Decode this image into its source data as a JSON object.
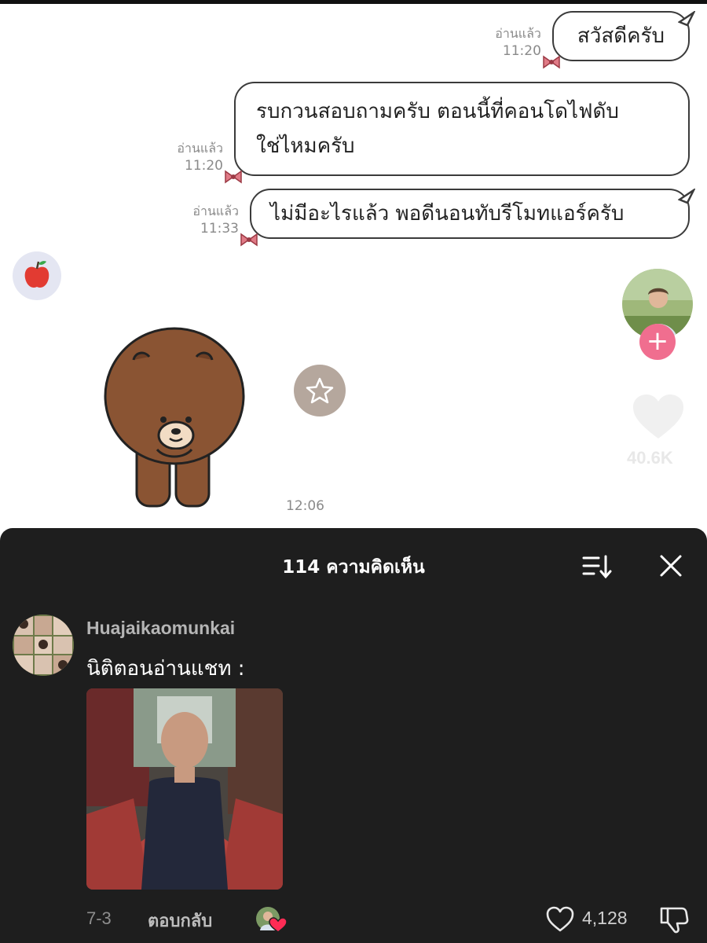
{
  "chat": {
    "messages": [
      {
        "text": "สวัสดีครับ",
        "read_label": "อ่านแล้ว",
        "time": "11:20"
      },
      {
        "line1": "รบกวนสอบถามครับ ตอนนี้ที่คอนโดไฟดับ",
        "line2": "ใช่ไหมครับ",
        "read_label": "อ่านแล้ว",
        "time": "11:20"
      },
      {
        "text": "ไม่มีอะไรแล้ว พอดีนอนทับรีโมทแอร์ครับ",
        "read_label": "อ่านแล้ว",
        "time": "11:33"
      }
    ],
    "sticker_time": "12:06",
    "colors": {
      "bear": "#8a5433",
      "bubble_border": "#3b3b3b",
      "bow": "#e07a86"
    }
  },
  "video_overlay": {
    "follow_symbol": "+",
    "like_count": "40.6K",
    "icons": [
      "star-icon",
      "plus-icon",
      "heart-icon"
    ],
    "colors": {
      "follow": "#f06e8f"
    }
  },
  "comments_panel": {
    "title": "114 ความคิดเห็น",
    "icons": [
      "sort-icon",
      "close-icon"
    ],
    "comment": {
      "username": "Huajaikaomunkai",
      "text": "นิติตอนอ่านแชท :",
      "date": "7-3",
      "reply_label": "ตอบกลับ",
      "like_count": "4,128",
      "icons": [
        "heart-icon",
        "dislike-icon"
      ]
    },
    "colors": {
      "background": "#1e1e1e",
      "creator_heart": "#fe2c55"
    }
  }
}
